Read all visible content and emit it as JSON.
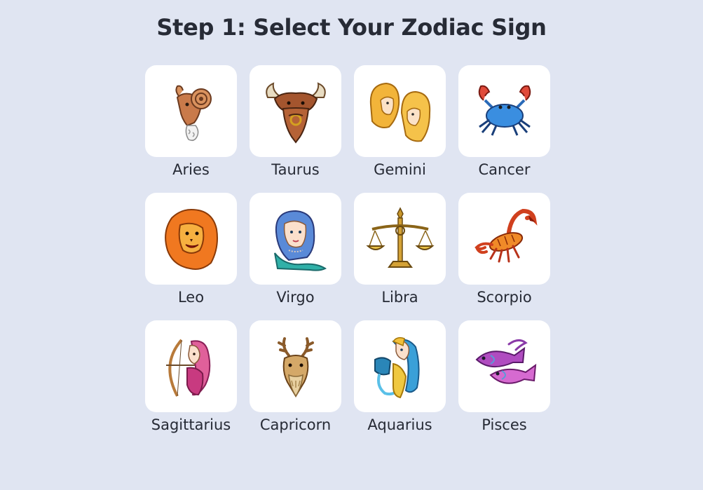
{
  "heading": "Step 1: Select Your Zodiac Sign",
  "signs": [
    {
      "name": "Aries",
      "icon": "ram-icon"
    },
    {
      "name": "Taurus",
      "icon": "bull-icon"
    },
    {
      "name": "Gemini",
      "icon": "twins-icon"
    },
    {
      "name": "Cancer",
      "icon": "crab-icon"
    },
    {
      "name": "Leo",
      "icon": "lion-icon"
    },
    {
      "name": "Virgo",
      "icon": "maiden-icon"
    },
    {
      "name": "Libra",
      "icon": "scales-icon"
    },
    {
      "name": "Scorpio",
      "icon": "scorpion-icon"
    },
    {
      "name": "Sagittarius",
      "icon": "archer-icon"
    },
    {
      "name": "Capricorn",
      "icon": "goat-icon"
    },
    {
      "name": "Aquarius",
      "icon": "water-bearer-icon"
    },
    {
      "name": "Pisces",
      "icon": "fish-icon"
    }
  ],
  "colors": {
    "background": "#e0e5f2",
    "card": "#ffffff",
    "text": "#272b36"
  }
}
